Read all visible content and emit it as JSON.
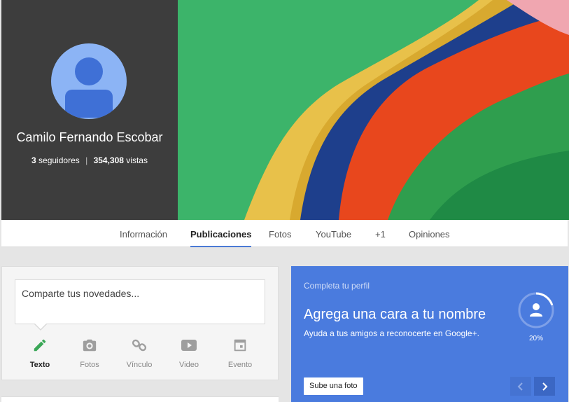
{
  "profile": {
    "name": "Camilo Fernando Escobar",
    "followers": "3",
    "followers_label": "seguidores",
    "views": "354,308",
    "views_label": "vistas",
    "separator": "|"
  },
  "tabs": [
    {
      "label": "Información"
    },
    {
      "label": "Publicaciones",
      "active": true
    },
    {
      "label": "Fotos"
    },
    {
      "label": "YouTube"
    },
    {
      "label": "+1"
    },
    {
      "label": "Opiniones"
    }
  ],
  "share": {
    "placeholder": "Comparte tus novedades...",
    "actions": [
      {
        "label": "Texto",
        "icon": "pencil-icon",
        "color": "#3aa757",
        "active": true
      },
      {
        "label": "Fotos",
        "icon": "camera-icon",
        "color": "#9e9e9e"
      },
      {
        "label": "Vínculo",
        "icon": "link-icon",
        "color": "#9e9e9e"
      },
      {
        "label": "Video",
        "icon": "video-icon",
        "color": "#9e9e9e"
      },
      {
        "label": "Evento",
        "icon": "calendar-icon",
        "color": "#9e9e9e"
      }
    ]
  },
  "complete_profile": {
    "kicker": "Completa tu perfil",
    "title": "Agrega una cara a tu nombre",
    "subtitle": "Ayuda a tus amigos a reconocerte en Google+.",
    "progress_label": "20%",
    "progress": 0.2,
    "button_label": "Sube una foto",
    "prev_icon": "chevron-left-icon",
    "next_icon": "chevron-right-icon",
    "background": "#4a7bde"
  },
  "colors": {
    "accent": "#4a7ad6",
    "profile_panel": "#3d3d3d"
  }
}
